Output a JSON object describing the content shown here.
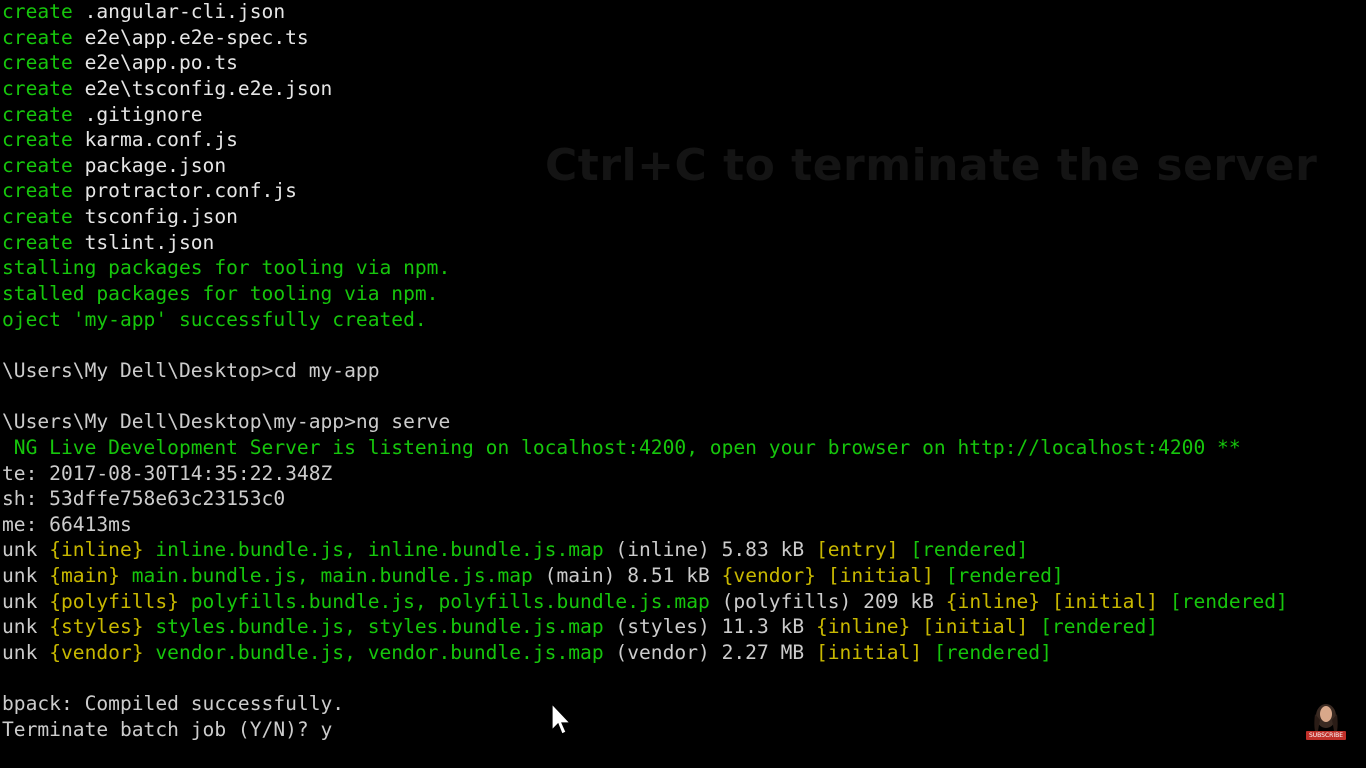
{
  "overlay": {
    "caption": "Ctrl+C to terminate the server"
  },
  "console": {
    "lines": [
      [
        {
          "t": "create",
          "c": "g"
        },
        {
          "t": " .angular-cli.json",
          "c": "bw"
        }
      ],
      [
        {
          "t": "create",
          "c": "g"
        },
        {
          "t": " e2e\\app.e2e-spec.ts",
          "c": "bw"
        }
      ],
      [
        {
          "t": "create",
          "c": "g"
        },
        {
          "t": " e2e\\app.po.ts",
          "c": "bw"
        }
      ],
      [
        {
          "t": "create",
          "c": "g"
        },
        {
          "t": " e2e\\tsconfig.e2e.json",
          "c": "bw"
        }
      ],
      [
        {
          "t": "create",
          "c": "g"
        },
        {
          "t": " .gitignore",
          "c": "bw"
        }
      ],
      [
        {
          "t": "create",
          "c": "g"
        },
        {
          "t": " karma.conf.js",
          "c": "bw"
        }
      ],
      [
        {
          "t": "create",
          "c": "g"
        },
        {
          "t": " package.json",
          "c": "bw"
        }
      ],
      [
        {
          "t": "create",
          "c": "g"
        },
        {
          "t": " protractor.conf.js",
          "c": "bw"
        }
      ],
      [
        {
          "t": "create",
          "c": "g"
        },
        {
          "t": " tsconfig.json",
          "c": "bw"
        }
      ],
      [
        {
          "t": "create",
          "c": "g"
        },
        {
          "t": " tslint.json",
          "c": "bw"
        }
      ],
      [
        {
          "t": "stalling packages for tooling via npm.",
          "c": "g"
        }
      ],
      [
        {
          "t": "stalled packages for tooling via npm.",
          "c": "g"
        }
      ],
      [
        {
          "t": "oject 'my-app' successfully created.",
          "c": "g"
        }
      ],
      [],
      [
        {
          "t": "\\Users\\My Dell\\Desktop>cd my-app",
          "c": "w"
        }
      ],
      [],
      [
        {
          "t": "\\Users\\My Dell\\Desktop\\my-app>ng serve",
          "c": "w"
        }
      ],
      [
        {
          "t": " NG Live Development Server is listening on localhost:4200, open your browser on http://localhost:4200 **",
          "c": "g"
        }
      ],
      [
        {
          "t": "te: 2017-08-30T14:35:22.348Z",
          "c": "w"
        }
      ],
      [
        {
          "t": "sh: 53dffe758e63c23153c0",
          "c": "w"
        }
      ],
      [
        {
          "t": "me: 66413ms",
          "c": "w"
        }
      ],
      [
        {
          "t": "unk ",
          "c": "w"
        },
        {
          "t": "{inline}",
          "c": "y"
        },
        {
          "t": " inline.bundle.js, inline.bundle.js.map",
          "c": "g"
        },
        {
          "t": " (inline) 5.83 kB ",
          "c": "w"
        },
        {
          "t": "[entry]",
          "c": "y"
        },
        {
          "t": " ",
          "c": "w"
        },
        {
          "t": "[rendered]",
          "c": "g"
        }
      ],
      [
        {
          "t": "unk ",
          "c": "w"
        },
        {
          "t": "{main}",
          "c": "y"
        },
        {
          "t": " main.bundle.js, main.bundle.js.map",
          "c": "g"
        },
        {
          "t": " (main) 8.51 kB ",
          "c": "w"
        },
        {
          "t": "{vendor}",
          "c": "y"
        },
        {
          "t": " ",
          "c": "w"
        },
        {
          "t": "[initial]",
          "c": "y"
        },
        {
          "t": " ",
          "c": "w"
        },
        {
          "t": "[rendered]",
          "c": "g"
        }
      ],
      [
        {
          "t": "unk ",
          "c": "w"
        },
        {
          "t": "{polyfills}",
          "c": "y"
        },
        {
          "t": " polyfills.bundle.js, polyfills.bundle.js.map",
          "c": "g"
        },
        {
          "t": " (polyfills) 209 kB ",
          "c": "w"
        },
        {
          "t": "{inline}",
          "c": "y"
        },
        {
          "t": " ",
          "c": "w"
        },
        {
          "t": "[initial]",
          "c": "y"
        },
        {
          "t": " ",
          "c": "w"
        },
        {
          "t": "[rendered]",
          "c": "g"
        }
      ],
      [
        {
          "t": "unk ",
          "c": "w"
        },
        {
          "t": "{styles}",
          "c": "y"
        },
        {
          "t": " styles.bundle.js, styles.bundle.js.map",
          "c": "g"
        },
        {
          "t": " (styles) 11.3 kB ",
          "c": "w"
        },
        {
          "t": "{inline}",
          "c": "y"
        },
        {
          "t": " ",
          "c": "w"
        },
        {
          "t": "[initial]",
          "c": "y"
        },
        {
          "t": " ",
          "c": "w"
        },
        {
          "t": "[rendered]",
          "c": "g"
        }
      ],
      [
        {
          "t": "unk ",
          "c": "w"
        },
        {
          "t": "{vendor}",
          "c": "y"
        },
        {
          "t": " vendor.bundle.js, vendor.bundle.js.map",
          "c": "g"
        },
        {
          "t": " (vendor) 2.27 MB ",
          "c": "w"
        },
        {
          "t": "[initial]",
          "c": "y"
        },
        {
          "t": " ",
          "c": "w"
        },
        {
          "t": "[rendered]",
          "c": "g"
        }
      ],
      [],
      [
        {
          "t": "bpack: Compiled successfully.",
          "c": "w"
        }
      ],
      [
        {
          "t": "Terminate batch job (Y/N)? y",
          "c": "w"
        }
      ]
    ]
  },
  "logo": {
    "subscribe_label": "SUBSCRIBE"
  },
  "colors": {
    "background": "#000000",
    "green": "#16c60c",
    "yellow": "#c8b800",
    "white": "#cccccc"
  },
  "icons": {
    "pointer": "mouse-pointer-icon",
    "logo": "channel-logo-icon"
  }
}
